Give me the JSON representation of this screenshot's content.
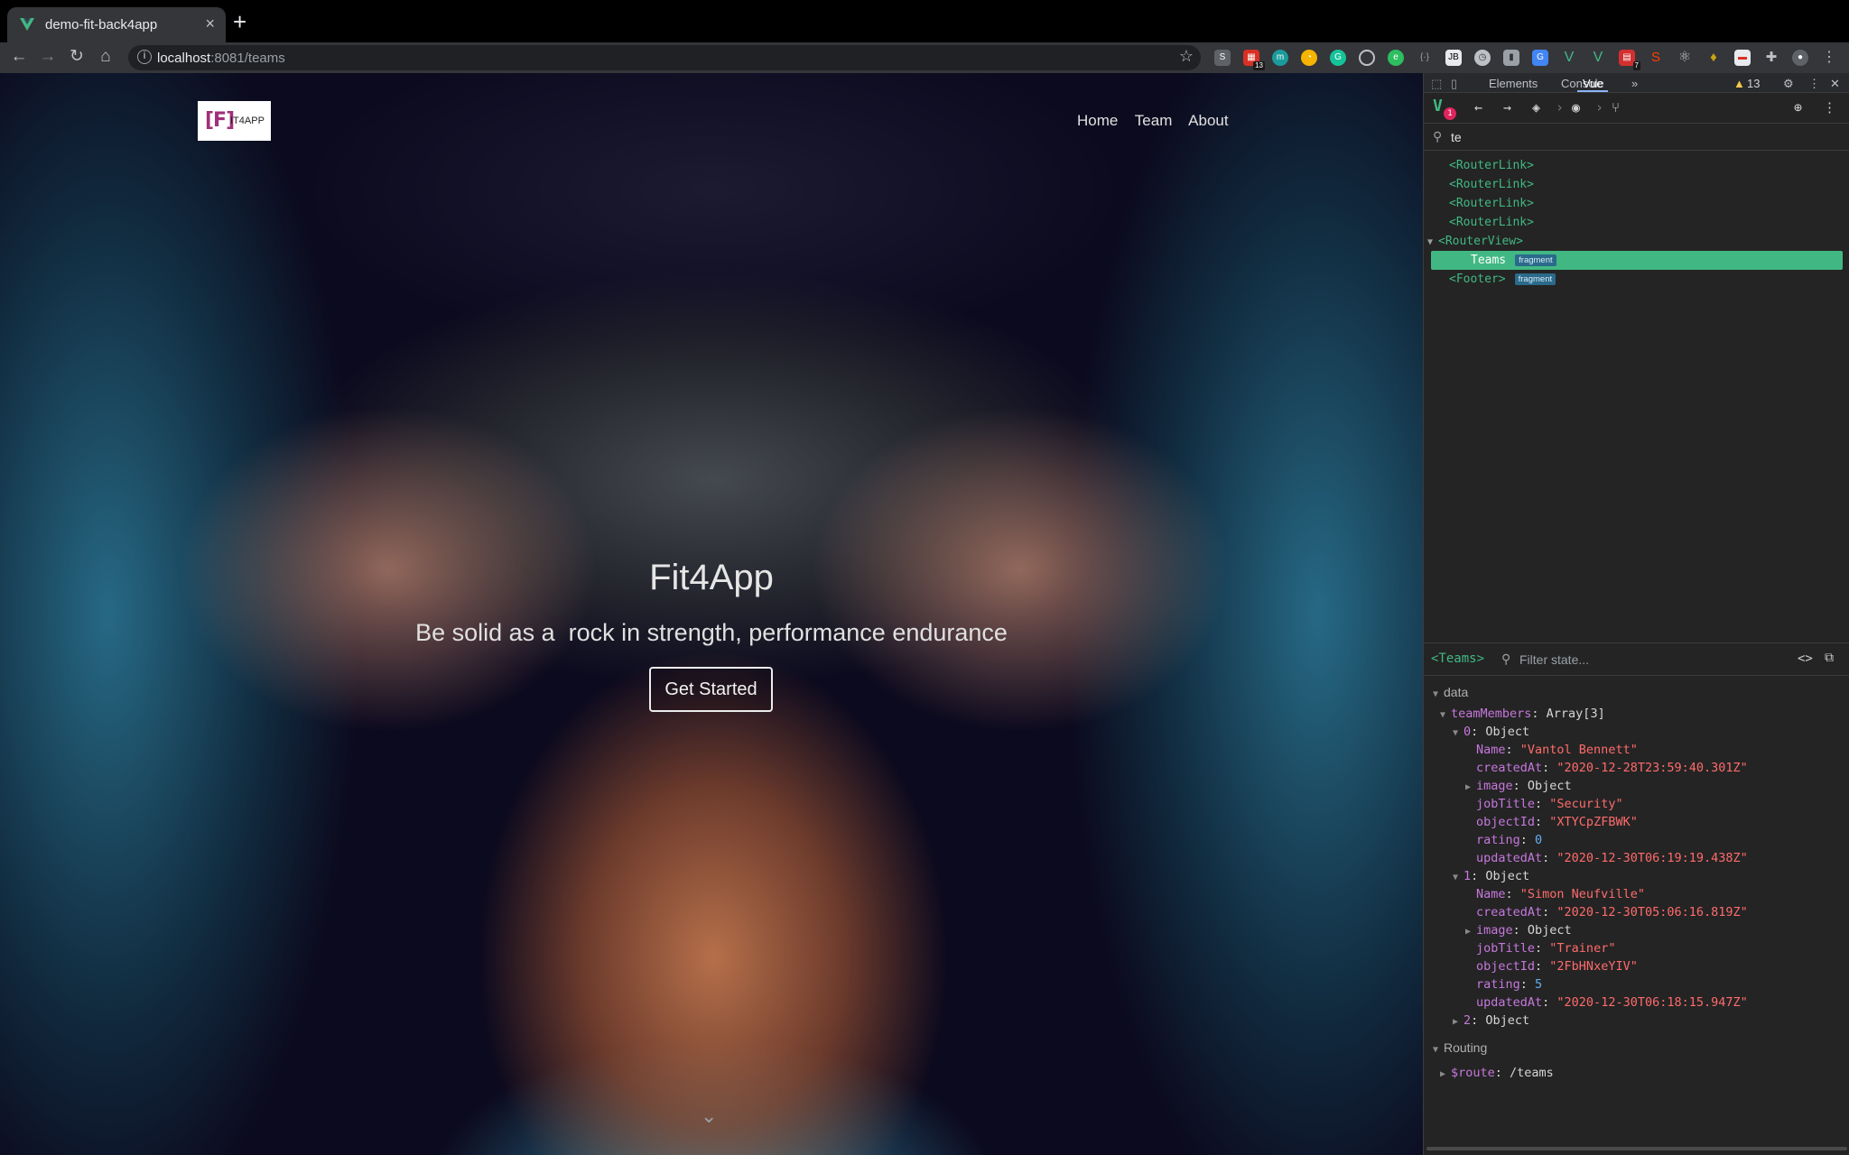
{
  "browser": {
    "tab_title": "demo-fit-back4app",
    "close_glyph": "×",
    "newtab_glyph": "+",
    "url_host": "localhost",
    "url_rest": ":8081/teams",
    "nav": {
      "back": "←",
      "forward": "→",
      "reload": "↻",
      "home": "⌂",
      "star": "☆"
    },
    "extension_badges": {
      "calendar": "13",
      "lastpass": "7"
    }
  },
  "site": {
    "logo_mark": "[F]",
    "logo_text": "IT4APP",
    "nav": [
      "Home",
      "Team",
      "About"
    ],
    "hero_title": "Fit4App",
    "hero_subtitle": "Be solid as a  rock in strength, performance endurance",
    "cta_label": "Get Started",
    "scroll_glyph": "⌄"
  },
  "devtools": {
    "tabs": [
      "Elements",
      "Console",
      "Vue"
    ],
    "active_tab": "Vue",
    "more_glyph": "»",
    "warnings": "13",
    "vue_badge": "1",
    "search_value": "te",
    "tree": [
      {
        "label": "<RouterLink>",
        "depth": 1
      },
      {
        "label": "<RouterLink>",
        "depth": 1
      },
      {
        "label": "<RouterLink>",
        "depth": 1
      },
      {
        "label": "<RouterLink>",
        "depth": 1
      },
      {
        "label": "<RouterView>",
        "depth": 0,
        "expanded": true
      },
      {
        "label": "Teams",
        "depth": 2,
        "selected": true,
        "tag": "fragment"
      },
      {
        "label": "<Footer>",
        "depth": 1,
        "tag": "fragment"
      }
    ],
    "state_component": "<Teams>",
    "filter_placeholder": "Filter state...",
    "state_sections": {
      "data_label": "data",
      "routing_label": "Routing"
    },
    "team_members_key": "teamMembers",
    "team_members_type": "Array[3]",
    "members": [
      {
        "index": "0",
        "type": "Object",
        "expanded": true,
        "fields": [
          {
            "key": "Name",
            "value": "\"Vantol Bennett\"",
            "kind": "str"
          },
          {
            "key": "createdAt",
            "value": "\"2020-12-28T23:59:40.301Z\"",
            "kind": "str"
          },
          {
            "key": "image",
            "value": "Object",
            "kind": "obj"
          },
          {
            "key": "jobTitle",
            "value": "\"Security\"",
            "kind": "str"
          },
          {
            "key": "objectId",
            "value": "\"XTYCpZFBWK\"",
            "kind": "str"
          },
          {
            "key": "rating",
            "value": "0",
            "kind": "num"
          },
          {
            "key": "updatedAt",
            "value": "\"2020-12-30T06:19:19.438Z\"",
            "kind": "str"
          }
        ]
      },
      {
        "index": "1",
        "type": "Object",
        "expanded": true,
        "fields": [
          {
            "key": "Name",
            "value": "\"Simon Neufville\"",
            "kind": "str"
          },
          {
            "key": "createdAt",
            "value": "\"2020-12-30T05:06:16.819Z\"",
            "kind": "str"
          },
          {
            "key": "image",
            "value": "Object",
            "kind": "obj"
          },
          {
            "key": "jobTitle",
            "value": "\"Trainer\"",
            "kind": "str"
          },
          {
            "key": "objectId",
            "value": "\"2FbHNxeYIV\"",
            "kind": "str"
          },
          {
            "key": "rating",
            "value": "5",
            "kind": "num"
          },
          {
            "key": "updatedAt",
            "value": "\"2020-12-30T06:18:15.947Z\"",
            "kind": "str"
          }
        ]
      },
      {
        "index": "2",
        "type": "Object",
        "expanded": false,
        "fields": []
      }
    ],
    "route_key": "$route",
    "route_value": "/teams"
  }
}
